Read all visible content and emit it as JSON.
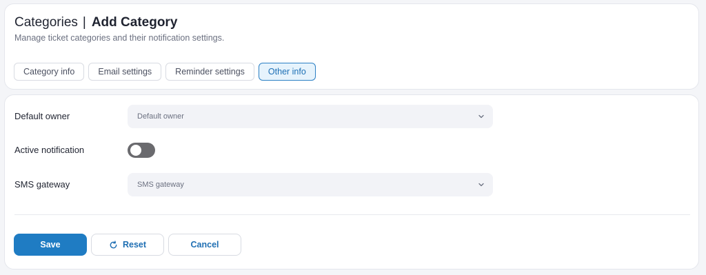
{
  "header": {
    "title": "Categories",
    "separator": "|",
    "subtitle_title": "Add Category",
    "description": "Manage ticket categories and their notification settings."
  },
  "tabs": [
    {
      "label": "Category info",
      "active": false
    },
    {
      "label": "Email settings",
      "active": false
    },
    {
      "label": "Reminder settings",
      "active": false
    },
    {
      "label": "Other info",
      "active": true
    }
  ],
  "form": {
    "default_owner": {
      "label": "Default owner",
      "placeholder": "Default owner",
      "icon": "chevron-down-icon"
    },
    "active_notification": {
      "label": "Active notification",
      "enabled": false
    },
    "sms_gateway": {
      "label": "SMS gateway",
      "placeholder": "SMS gateway",
      "icon": "chevron-down-icon"
    }
  },
  "actions": {
    "save_label": "Save",
    "reset_label": "Reset",
    "reset_icon": "refresh-icon",
    "cancel_label": "Cancel"
  },
  "colors": {
    "primary": "#1f7cc3",
    "active_tab_bg": "#e6f3fc",
    "toggle_off": "#6a6a6e"
  }
}
